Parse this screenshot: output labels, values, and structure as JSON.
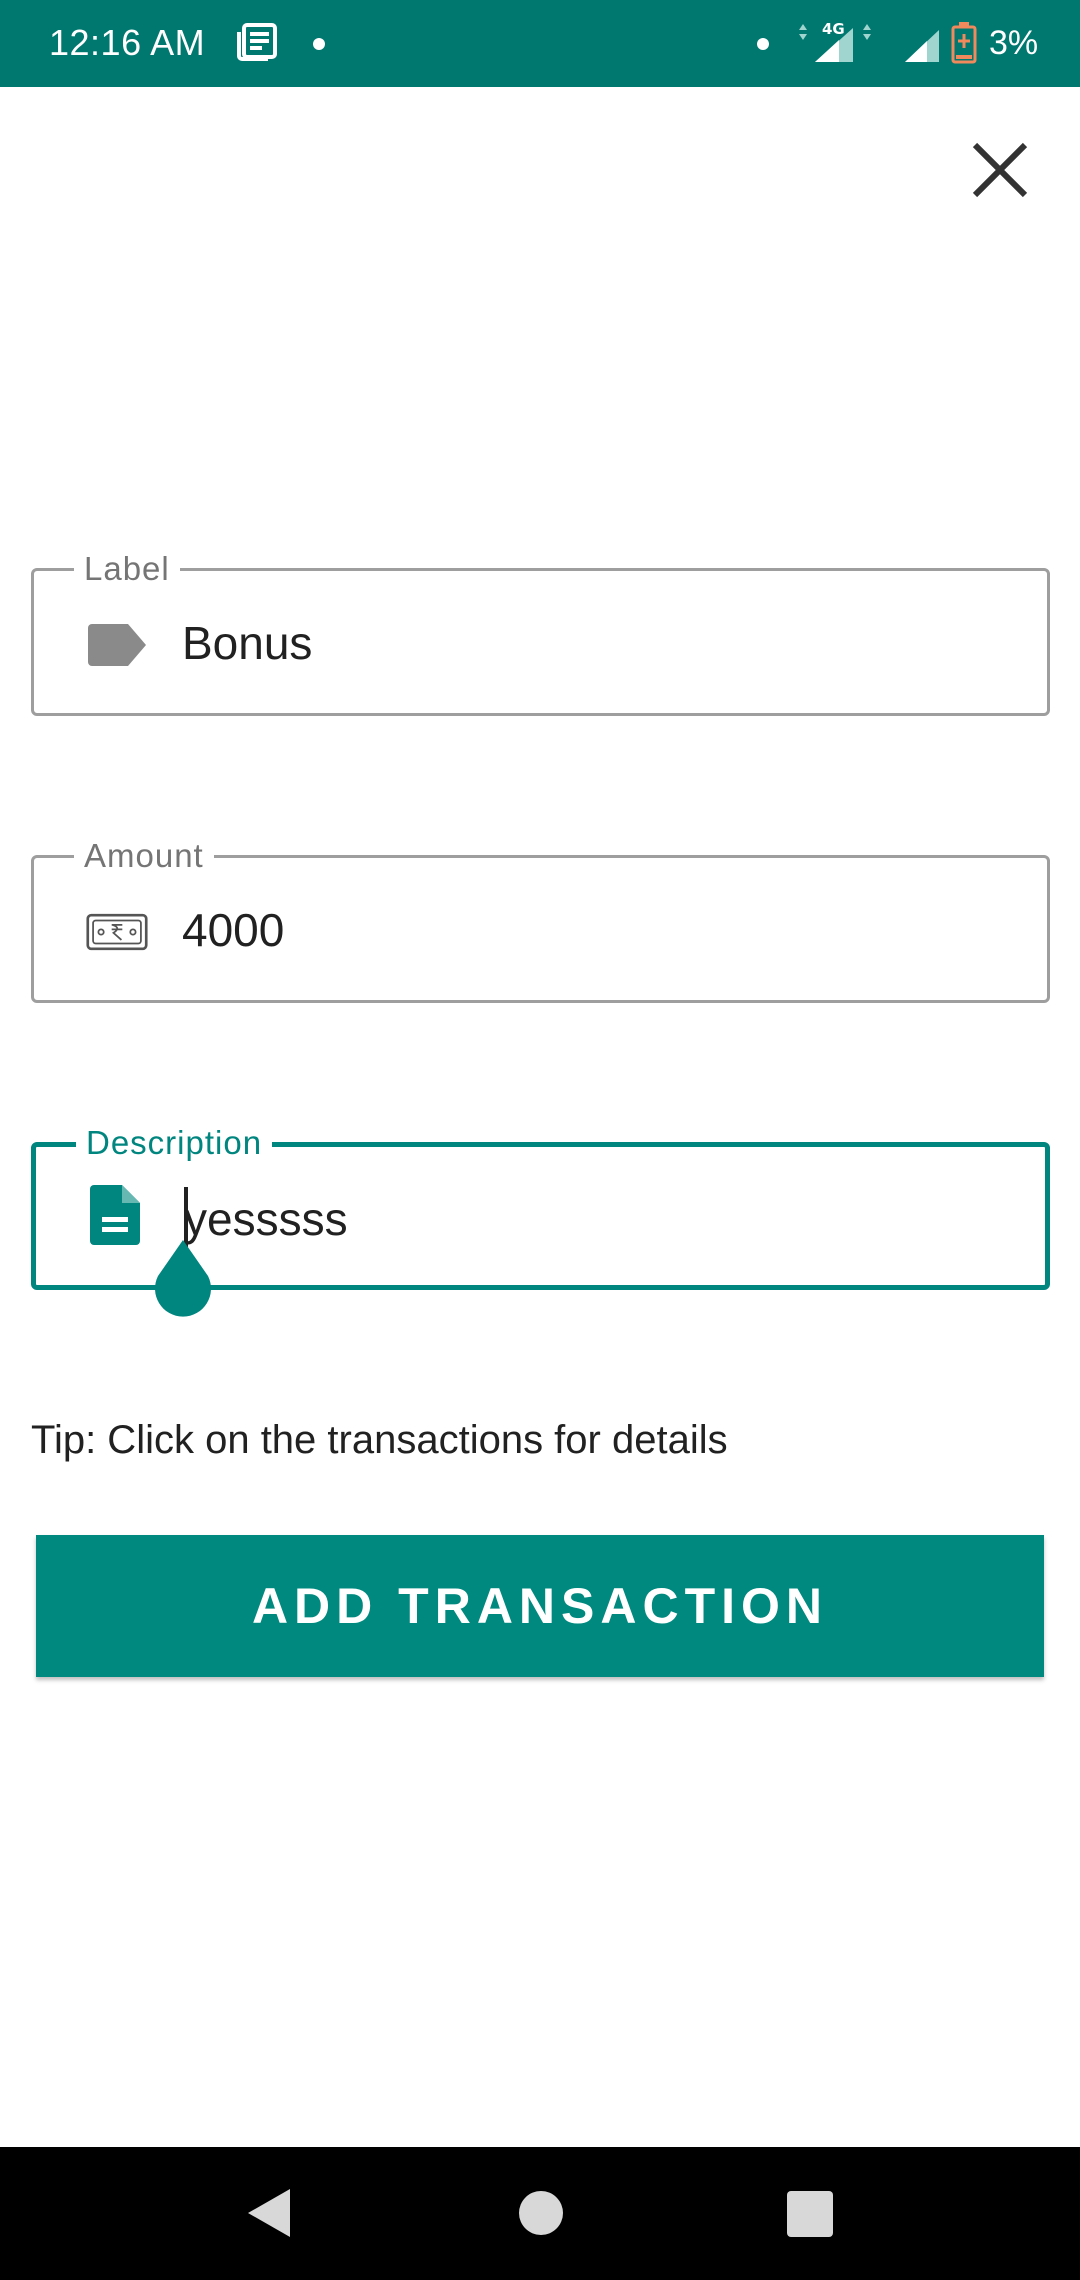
{
  "status_bar": {
    "time": "12:16 AM",
    "network": "4G",
    "battery": "3%"
  },
  "close": {
    "icon": "close-icon"
  },
  "form": {
    "label_field": {
      "label": "Label",
      "value": "Bonus",
      "icon": "tag-icon"
    },
    "amount_field": {
      "label": "Amount",
      "value": "4000",
      "icon": "money-icon"
    },
    "description_field": {
      "label": "Description",
      "value": "yesssss",
      "icon": "document-icon"
    }
  },
  "tip": "Tip: Click on the transactions for details",
  "submit": {
    "label": "ADD TRANSACTION"
  },
  "colors": {
    "status_bar": "#00786F",
    "accent": "#00897F",
    "focused_border": "#00857F",
    "idle_border": "#9e9e9e"
  }
}
